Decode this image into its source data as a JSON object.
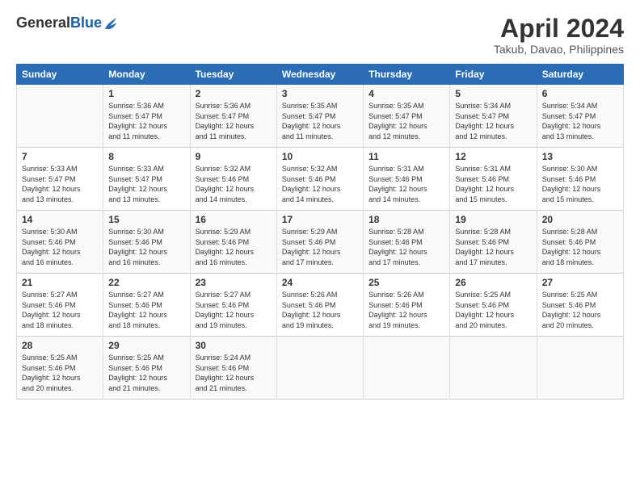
{
  "header": {
    "logo_general": "General",
    "logo_blue": "Blue",
    "month": "April 2024",
    "location": "Takub, Davao, Philippines"
  },
  "weekdays": [
    "Sunday",
    "Monday",
    "Tuesday",
    "Wednesday",
    "Thursday",
    "Friday",
    "Saturday"
  ],
  "weeks": [
    [
      {
        "day": "",
        "info": ""
      },
      {
        "day": "1",
        "info": "Sunrise: 5:36 AM\nSunset: 5:47 PM\nDaylight: 12 hours\nand 11 minutes."
      },
      {
        "day": "2",
        "info": "Sunrise: 5:36 AM\nSunset: 5:47 PM\nDaylight: 12 hours\nand 11 minutes."
      },
      {
        "day": "3",
        "info": "Sunrise: 5:35 AM\nSunset: 5:47 PM\nDaylight: 12 hours\nand 11 minutes."
      },
      {
        "day": "4",
        "info": "Sunrise: 5:35 AM\nSunset: 5:47 PM\nDaylight: 12 hours\nand 12 minutes."
      },
      {
        "day": "5",
        "info": "Sunrise: 5:34 AM\nSunset: 5:47 PM\nDaylight: 12 hours\nand 12 minutes."
      },
      {
        "day": "6",
        "info": "Sunrise: 5:34 AM\nSunset: 5:47 PM\nDaylight: 12 hours\nand 13 minutes."
      }
    ],
    [
      {
        "day": "7",
        "info": "Sunrise: 5:33 AM\nSunset: 5:47 PM\nDaylight: 12 hours\nand 13 minutes."
      },
      {
        "day": "8",
        "info": "Sunrise: 5:33 AM\nSunset: 5:47 PM\nDaylight: 12 hours\nand 13 minutes."
      },
      {
        "day": "9",
        "info": "Sunrise: 5:32 AM\nSunset: 5:46 PM\nDaylight: 12 hours\nand 14 minutes."
      },
      {
        "day": "10",
        "info": "Sunrise: 5:32 AM\nSunset: 5:46 PM\nDaylight: 12 hours\nand 14 minutes."
      },
      {
        "day": "11",
        "info": "Sunrise: 5:31 AM\nSunset: 5:46 PM\nDaylight: 12 hours\nand 14 minutes."
      },
      {
        "day": "12",
        "info": "Sunrise: 5:31 AM\nSunset: 5:46 PM\nDaylight: 12 hours\nand 15 minutes."
      },
      {
        "day": "13",
        "info": "Sunrise: 5:30 AM\nSunset: 5:46 PM\nDaylight: 12 hours\nand 15 minutes."
      }
    ],
    [
      {
        "day": "14",
        "info": "Sunrise: 5:30 AM\nSunset: 5:46 PM\nDaylight: 12 hours\nand 16 minutes."
      },
      {
        "day": "15",
        "info": "Sunrise: 5:30 AM\nSunset: 5:46 PM\nDaylight: 12 hours\nand 16 minutes."
      },
      {
        "day": "16",
        "info": "Sunrise: 5:29 AM\nSunset: 5:46 PM\nDaylight: 12 hours\nand 16 minutes."
      },
      {
        "day": "17",
        "info": "Sunrise: 5:29 AM\nSunset: 5:46 PM\nDaylight: 12 hours\nand 17 minutes."
      },
      {
        "day": "18",
        "info": "Sunrise: 5:28 AM\nSunset: 5:46 PM\nDaylight: 12 hours\nand 17 minutes."
      },
      {
        "day": "19",
        "info": "Sunrise: 5:28 AM\nSunset: 5:46 PM\nDaylight: 12 hours\nand 17 minutes."
      },
      {
        "day": "20",
        "info": "Sunrise: 5:28 AM\nSunset: 5:46 PM\nDaylight: 12 hours\nand 18 minutes."
      }
    ],
    [
      {
        "day": "21",
        "info": "Sunrise: 5:27 AM\nSunset: 5:46 PM\nDaylight: 12 hours\nand 18 minutes."
      },
      {
        "day": "22",
        "info": "Sunrise: 5:27 AM\nSunset: 5:46 PM\nDaylight: 12 hours\nand 18 minutes."
      },
      {
        "day": "23",
        "info": "Sunrise: 5:27 AM\nSunset: 5:46 PM\nDaylight: 12 hours\nand 19 minutes."
      },
      {
        "day": "24",
        "info": "Sunrise: 5:26 AM\nSunset: 5:46 PM\nDaylight: 12 hours\nand 19 minutes."
      },
      {
        "day": "25",
        "info": "Sunrise: 5:26 AM\nSunset: 5:46 PM\nDaylight: 12 hours\nand 19 minutes."
      },
      {
        "day": "26",
        "info": "Sunrise: 5:25 AM\nSunset: 5:46 PM\nDaylight: 12 hours\nand 20 minutes."
      },
      {
        "day": "27",
        "info": "Sunrise: 5:25 AM\nSunset: 5:46 PM\nDaylight: 12 hours\nand 20 minutes."
      }
    ],
    [
      {
        "day": "28",
        "info": "Sunrise: 5:25 AM\nSunset: 5:46 PM\nDaylight: 12 hours\nand 20 minutes."
      },
      {
        "day": "29",
        "info": "Sunrise: 5:25 AM\nSunset: 5:46 PM\nDaylight: 12 hours\nand 21 minutes."
      },
      {
        "day": "30",
        "info": "Sunrise: 5:24 AM\nSunset: 5:46 PM\nDaylight: 12 hours\nand 21 minutes."
      },
      {
        "day": "",
        "info": ""
      },
      {
        "day": "",
        "info": ""
      },
      {
        "day": "",
        "info": ""
      },
      {
        "day": "",
        "info": ""
      }
    ]
  ]
}
